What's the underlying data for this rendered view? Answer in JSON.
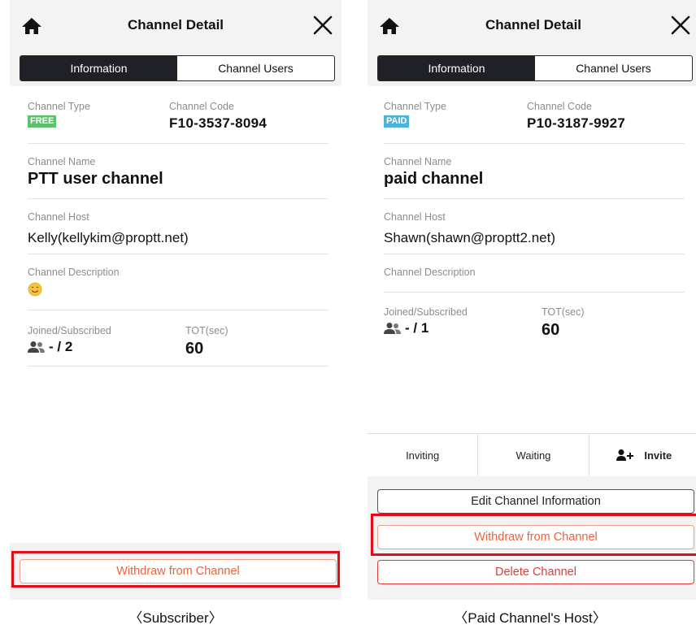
{
  "common": {
    "title": "Channel Detail",
    "tab_information": "Information",
    "tab_channel_users": "Channel Users",
    "label_channel_type": "Channel Type",
    "label_channel_code": "Channel Code",
    "label_channel_name": "Channel Name",
    "label_channel_host": "Channel Host",
    "label_channel_description": "Channel Description",
    "label_joined_subscribed": "Joined/Subscribed",
    "label_tot": "TOT(sec)"
  },
  "left": {
    "caption": "〈Subscriber〉",
    "channel_type_badge": "FREE",
    "channel_type_color": "#5bc26b",
    "channel_code": "F10-3537-8094",
    "channel_name": "PTT user channel",
    "channel_host": "Kelly(kellykim@proptt.net)",
    "channel_description_icon": "smiley-emoji-icon",
    "joined_subscribed": "- / 2",
    "tot": "60",
    "withdraw_button": "Withdraw from Channel"
  },
  "right": {
    "caption": "〈Paid Channel's Host〉",
    "channel_type_badge": "PAID",
    "channel_type_color": "#4fb3d9",
    "channel_code": "P10-3187-9927",
    "channel_name": "paid channel",
    "channel_host": "Shawn(shawn@proptt2.net)",
    "joined_subscribed": "- / 1",
    "tot": "60",
    "tab_inviting": "Inviting",
    "tab_waiting": "Waiting",
    "tab_invite": "Invite",
    "edit_button": "Edit Channel Information",
    "withdraw_button": "Withdraw from Channel",
    "delete_button": "Delete Channel"
  },
  "highlight_color": "#e10d1a"
}
